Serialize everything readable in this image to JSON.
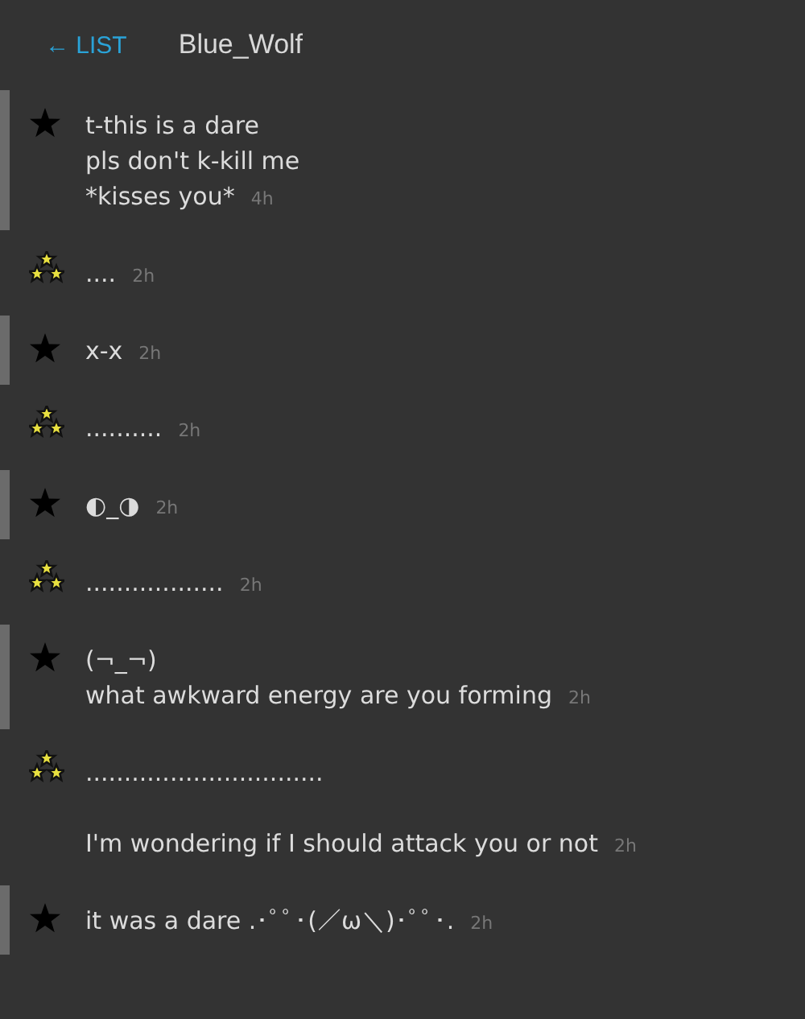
{
  "header": {
    "back": "← LIST",
    "title": "Blue_Wolf"
  },
  "messages": [
    {
      "kind": "single",
      "lines": [
        "t-this is a dare",
        "pls don't k-kill me",
        "*kisses you*"
      ],
      "time": "4h"
    },
    {
      "kind": "triad",
      "lines": [
        "...."
      ],
      "time": "2h"
    },
    {
      "kind": "single",
      "lines": [
        "x-x"
      ],
      "time": "2h"
    },
    {
      "kind": "triad",
      "lines": [
        ".........."
      ],
      "time": "2h"
    },
    {
      "kind": "single",
      "lines": [
        "◐_◑"
      ],
      "time": "2h"
    },
    {
      "kind": "triad",
      "lines": [
        ".................."
      ],
      "time": "2h"
    },
    {
      "kind": "single",
      "lines": [
        "(¬_¬)",
        "what awkward energy are you forming"
      ],
      "time": "2h"
    },
    {
      "kind": "triad",
      "lines": [
        "..............................."
      ]
    },
    {
      "kind": "continuation",
      "lines": [
        "I'm wondering if I should attack you or not"
      ],
      "time": "2h"
    },
    {
      "kind": "single",
      "lines": [
        "it was a dare .･ﾟﾟ･(／ω＼)･ﾟﾟ･."
      ],
      "time": "2h"
    }
  ]
}
